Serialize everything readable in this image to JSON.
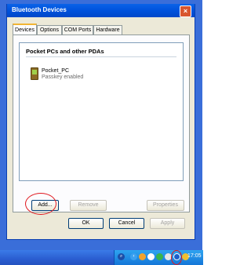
{
  "window": {
    "title": "Bluetooth Devices",
    "close_label": "×"
  },
  "tabs": [
    {
      "label": "Devices"
    },
    {
      "label": "Options"
    },
    {
      "label": "COM Ports"
    },
    {
      "label": "Hardware"
    }
  ],
  "device_list": {
    "group_header": "Pocket PCs and other PDAs",
    "devices": [
      {
        "name": "Pocket_PC",
        "status": "Passkey enabled"
      }
    ]
  },
  "panel_buttons": {
    "add": "Add...",
    "remove": "Remove",
    "properties": "Properties"
  },
  "dialog_buttons": {
    "ok": "OK",
    "cancel": "Cancel",
    "apply": "Apply"
  },
  "taskbar": {
    "clock": "17:05"
  },
  "colors": {
    "annotation_circle": "#e0161d",
    "desktop": "#3a6ed9",
    "titlebar": "#0052dc"
  }
}
